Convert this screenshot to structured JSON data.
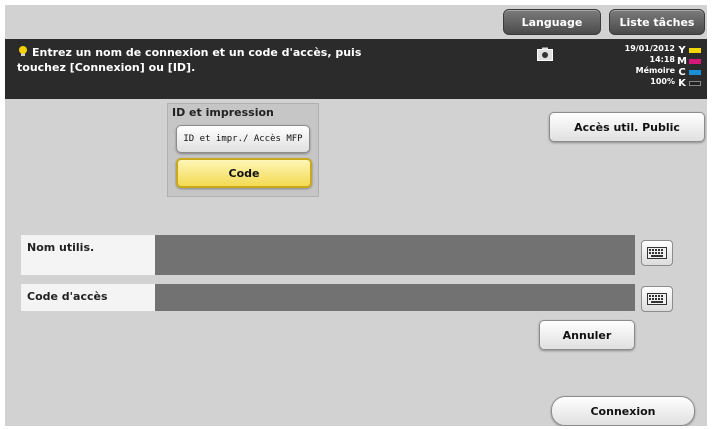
{
  "top_buttons": {
    "language": "Language",
    "task_list": "Liste tâches"
  },
  "message": {
    "text": "Entrez un nom de connexion et un code d'accès, puis touchez [Connexion] ou [ID]."
  },
  "status": {
    "date": "19/01/2012",
    "time": "14:18",
    "memory_label": "Mémoire",
    "memory_value": "100%"
  },
  "toner": [
    {
      "letter": "Y",
      "color": "#f3d800"
    },
    {
      "letter": "M",
      "color": "#d6187a"
    },
    {
      "letter": "C",
      "color": "#1a8fd6"
    },
    {
      "letter": "K",
      "color": "#222222"
    }
  ],
  "id_panel": {
    "title": "ID et impression",
    "mfp_button": "ID et impr./ Accès MFP",
    "code_button": "Code"
  },
  "public_access_button": "Accès util. Public",
  "fields": {
    "user_name": {
      "label": "Nom utilis.",
      "value": ""
    },
    "password": {
      "label": "Code d'accès",
      "value": ""
    }
  },
  "cancel_button": "Annuler",
  "login_button": "Connexion",
  "colors": {
    "message_bar": "#2b2b2b",
    "screen_bg": "#d2d2d2",
    "selected_yellow": "#f2da52",
    "input_gray": "#727272"
  }
}
